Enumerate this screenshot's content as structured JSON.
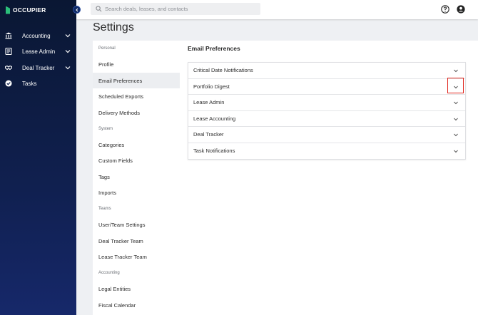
{
  "app": {
    "logo_text": "OCCUPIER"
  },
  "sidebar": {
    "items": [
      {
        "label": "Accounting",
        "icon": "bank-icon",
        "expandable": true
      },
      {
        "label": "Lease Admin",
        "icon": "document-icon",
        "expandable": true
      },
      {
        "label": "Deal Tracker",
        "icon": "handshake-icon",
        "expandable": true
      },
      {
        "label": "Tasks",
        "icon": "check-circle-icon",
        "expandable": false
      }
    ]
  },
  "header": {
    "search_placeholder": "Search deals, leases, and contacts",
    "help_icon": "help-circle-icon",
    "account_icon": "account-circle-icon"
  },
  "page": {
    "title": "Settings"
  },
  "settings_nav": {
    "sections": [
      {
        "title": "Personal",
        "items": [
          "Profile",
          "Email Preferences",
          "Scheduled Exports",
          "Delivery Methods"
        ]
      },
      {
        "title": "System",
        "items": [
          "Categories",
          "Custom Fields",
          "Tags",
          "Imports"
        ]
      },
      {
        "title": "Teams",
        "items": [
          "User/Team Settings",
          "Deal Tracker Team",
          "Lease Tracker Team"
        ]
      },
      {
        "title": "Accounting",
        "items": [
          "Legal Entities",
          "Fiscal Calendar"
        ]
      }
    ],
    "active_item": "Email Preferences"
  },
  "content": {
    "title": "Email Preferences",
    "accordion": [
      "Critical Date Notifications",
      "Portfolio Digest",
      "Lease Admin",
      "Lease Accounting",
      "Deal Tracker",
      "Task Notifications"
    ]
  },
  "colors": {
    "sidebar_top": "#0a1733",
    "sidebar_bottom": "#16286a",
    "brand_green": "#2bbf7a",
    "highlight": "#e0261d",
    "active_bg": "#eceef1"
  }
}
